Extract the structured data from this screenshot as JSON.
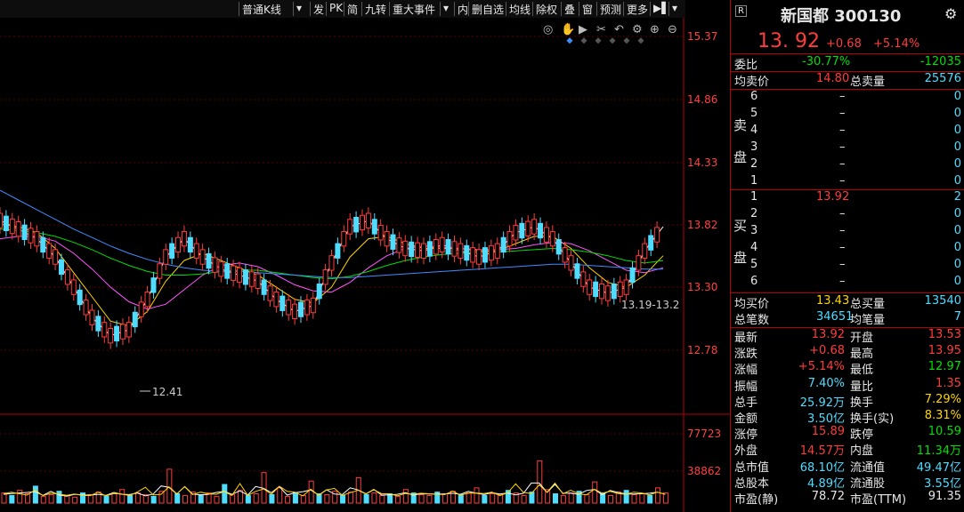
{
  "toolbar": {
    "items": [
      "普通K线",
      "▾",
      "发",
      "PK",
      "简",
      "九转",
      "重大事件",
      "▾",
      "内",
      "删自选",
      "均线",
      "除权",
      "叠",
      "窗",
      "预测",
      "更多",
      "▶▌",
      "▾"
    ]
  },
  "chart_icons": [
    "eye-icon",
    "hand-icon",
    "play-icon",
    "scissors-icon",
    "undo-icon",
    "settings-icon",
    "clock-icon",
    "zoom-in-icon",
    "zoom-out-icon"
  ],
  "chart_data": {
    "type": "line",
    "price_axis": [
      "15.37",
      "14.86",
      "14.33",
      "13.82",
      "13.30",
      "12.78"
    ],
    "volume_axis": [
      "77723",
      "38862"
    ],
    "annotations": {
      "low_label": "12.41",
      "range_label": "13.19-13.2"
    },
    "series": [
      {
        "color": "#ffffff",
        "values": [
          13.85,
          13.78,
          13.7,
          13.55,
          13.3,
          13.05,
          12.9,
          12.95,
          13.2,
          13.55,
          13.7,
          13.55,
          13.45,
          13.4,
          13.35,
          13.2,
          13.1,
          13.15,
          13.5,
          13.8,
          13.85,
          13.7,
          13.62,
          13.6,
          13.65,
          13.6,
          13.55,
          13.6,
          13.75,
          13.8,
          13.7,
          13.5,
          13.3,
          13.25,
          13.3,
          13.6,
          13.8
        ]
      },
      {
        "color": "#ffd400",
        "values": [
          13.82,
          13.8,
          13.75,
          13.62,
          13.42,
          13.22,
          13.02,
          12.98,
          13.1,
          13.35,
          13.52,
          13.58,
          13.52,
          13.46,
          13.4,
          13.3,
          13.2,
          13.17,
          13.3,
          13.55,
          13.7,
          13.72,
          13.66,
          13.62,
          13.62,
          13.62,
          13.6,
          13.6,
          13.66,
          13.72,
          13.72,
          13.62,
          13.46,
          13.34,
          13.3,
          13.4,
          13.56
        ]
      },
      {
        "color": "#ff55ff",
        "values": [
          13.7,
          13.72,
          13.72,
          13.68,
          13.58,
          13.45,
          13.3,
          13.18,
          13.12,
          13.16,
          13.28,
          13.4,
          13.48,
          13.5,
          13.47,
          13.4,
          13.32,
          13.27,
          13.26,
          13.34,
          13.46,
          13.56,
          13.62,
          13.64,
          13.63,
          13.62,
          13.61,
          13.61,
          13.62,
          13.65,
          13.67,
          13.66,
          13.6,
          13.52,
          13.44,
          13.42,
          13.46
        ]
      },
      {
        "color": "#00dd00",
        "values": [
          13.78,
          13.77,
          13.75,
          13.72,
          13.67,
          13.61,
          13.54,
          13.48,
          13.43,
          13.4,
          13.4,
          13.41,
          13.43,
          13.44,
          13.44,
          13.42,
          13.4,
          13.38,
          13.37,
          13.39,
          13.43,
          13.48,
          13.52,
          13.55,
          13.57,
          13.58,
          13.59,
          13.59,
          13.6,
          13.61,
          13.62,
          13.61,
          13.59,
          13.56,
          13.52,
          13.5,
          13.52
        ]
      },
      {
        "color": "#3f8cff",
        "values": [
          14.1,
          14.02,
          13.94,
          13.86,
          13.78,
          13.71,
          13.64,
          13.58,
          13.53,
          13.49,
          13.46,
          13.44,
          13.43,
          13.43,
          13.42,
          13.41,
          13.4,
          13.39,
          13.38,
          13.38,
          13.39,
          13.4,
          13.41,
          13.42,
          13.43,
          13.44,
          13.45,
          13.46,
          13.47,
          13.48,
          13.49,
          13.49,
          13.48,
          13.47,
          13.46,
          13.45,
          13.45
        ]
      }
    ],
    "volume": [
      12,
      9,
      15,
      11,
      20,
      8,
      10,
      14,
      9,
      7,
      12,
      10,
      13,
      8,
      11,
      16,
      9,
      12,
      10,
      8,
      14,
      40,
      11,
      9,
      13,
      10,
      12,
      8,
      22,
      10,
      15,
      9,
      11,
      36,
      10,
      18,
      8,
      12,
      9,
      26,
      11,
      10,
      14,
      9,
      13,
      30,
      10,
      12,
      9,
      11,
      8,
      16,
      12,
      10,
      9,
      13,
      11,
      14,
      10,
      12,
      18,
      9,
      11,
      10,
      15,
      12,
      9,
      13,
      50,
      16,
      11,
      9,
      12,
      14,
      10,
      25,
      12,
      9,
      13,
      15,
      10,
      11,
      9,
      18,
      12
    ]
  },
  "quote": {
    "r_badge": "R",
    "name": "新国都 300130",
    "price": "13. 92",
    "change": "+0.68",
    "change_pct": "+5.14%",
    "weibi_label": "委比",
    "weibi_val": "-30.77%",
    "weibi_vol": "-12035",
    "avg_sell_label": "均卖价",
    "avg_sell_val": "14.80",
    "total_sell_label": "总卖量",
    "total_sell_val": "25576",
    "sell_label_1": "卖",
    "sell_label_2": "盘",
    "sell": [
      {
        "n": "6",
        "p": "–",
        "v": "0"
      },
      {
        "n": "5",
        "p": "–",
        "v": "0"
      },
      {
        "n": "4",
        "p": "–",
        "v": "0"
      },
      {
        "n": "3",
        "p": "–",
        "v": "0"
      },
      {
        "n": "2",
        "p": "–",
        "v": "0"
      },
      {
        "n": "1",
        "p": "–",
        "v": "0"
      }
    ],
    "buy_label_1": "买",
    "buy_label_2": "盘",
    "buy": [
      {
        "n": "1",
        "p": "13.92",
        "v": "2"
      },
      {
        "n": "2",
        "p": "–",
        "v": "0"
      },
      {
        "n": "3",
        "p": "–",
        "v": "0"
      },
      {
        "n": "4",
        "p": "–",
        "v": "0"
      },
      {
        "n": "5",
        "p": "–",
        "v": "0"
      },
      {
        "n": "6",
        "p": "–",
        "v": "0"
      }
    ],
    "avg_buy_label": "均买价",
    "avg_buy_val": "13.43",
    "total_buy_label": "总买量",
    "total_buy_val": "13540",
    "total_deals_label": "总笔数",
    "total_deals_val": "34651",
    "avg_deal_label": "均笔量",
    "avg_deal_val": "7",
    "stats": [
      {
        "l1": "最新",
        "v1": "13.92",
        "c1": "red",
        "l2": "开盘",
        "v2": "13.53",
        "c2": "red"
      },
      {
        "l1": "涨跌",
        "v1": "+0.68",
        "c1": "red",
        "l2": "最高",
        "v2": "13.95",
        "c2": "red"
      },
      {
        "l1": "涨幅",
        "v1": "+5.14%",
        "c1": "red",
        "l2": "最低",
        "v2": "12.97",
        "c2": "green"
      },
      {
        "l1": "振幅",
        "v1": "7.40%",
        "c1": "cyan",
        "l2": "量比",
        "v2": "1.35",
        "c2": "red"
      },
      {
        "l1": "总手",
        "v1": "25.92万",
        "c1": "cyan",
        "l2": "换手",
        "v2": "7.29%",
        "c2": "yellow"
      },
      {
        "l1": "金额",
        "v1": "3.50亿",
        "c1": "cyan",
        "l2": "换手(实)",
        "v2": "8.31%",
        "c2": "yellow"
      },
      {
        "l1": "涨停",
        "v1": "15.89",
        "c1": "red",
        "l2": "跌停",
        "v2": "10.59",
        "c2": "green"
      },
      {
        "l1": "外盘",
        "v1": "14.57万",
        "c1": "red",
        "l2": "内盘",
        "v2": "11.34万",
        "c2": "green"
      },
      {
        "l1": "总市值",
        "v1": "68.10亿",
        "c1": "cyan",
        "l2": "流通值",
        "v2": "49.47亿",
        "c2": "cyan"
      },
      {
        "l1": "总股本",
        "v1": "4.89亿",
        "c1": "cyan",
        "l2": "流通股",
        "v2": "3.55亿",
        "c2": "cyan"
      },
      {
        "l1": "市盈(静)",
        "v1": "78.72",
        "c1": "white",
        "l2": "市盈(TTM)",
        "v2": "91.35",
        "c2": "white"
      }
    ]
  }
}
